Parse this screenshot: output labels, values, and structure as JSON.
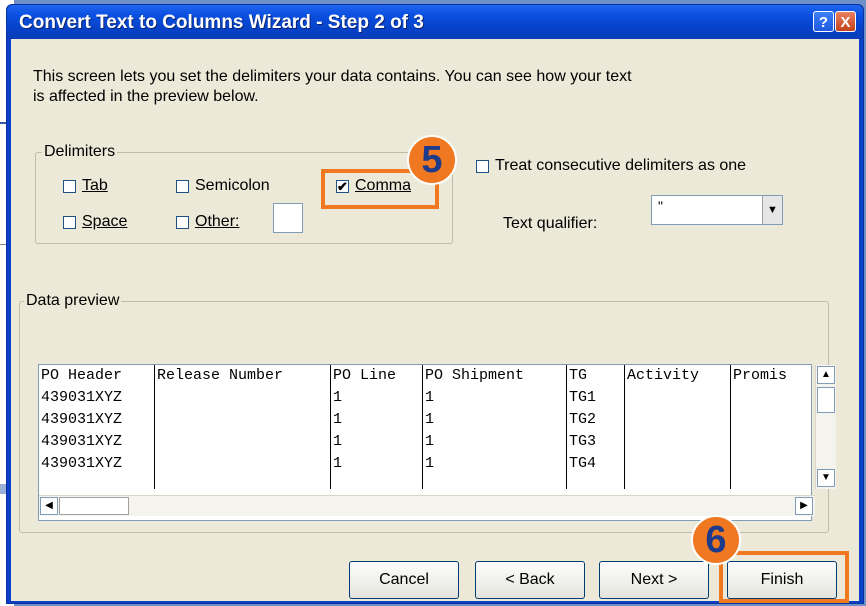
{
  "window": {
    "title": "Convert Text to Columns Wizard - Step 2 of 3",
    "help_glyph": "?",
    "close_glyph": "X"
  },
  "description": "This screen lets you set the delimiters your data contains.  You can see how your text is affected in the preview below.",
  "delimiters": {
    "legend": "Delimiters",
    "tab": {
      "label": "Tab",
      "checked": false
    },
    "semicolon": {
      "label": "Semicolon",
      "checked": false
    },
    "comma": {
      "label": "Comma",
      "checked": true,
      "check_glyph": "✔"
    },
    "space": {
      "label": "Space",
      "checked": false
    },
    "other": {
      "label": "Other:",
      "checked": false,
      "value": ""
    }
  },
  "consecutive": {
    "label": "Treat consecutive delimiters as one",
    "checked": false
  },
  "text_qualifier": {
    "label": "Text qualifier:",
    "value": "\""
  },
  "data_preview": {
    "legend": "Data preview",
    "columns": [
      {
        "cells": [
          "PO Header",
          "439031XYZ",
          "439031XYZ",
          "439031XYZ",
          "439031XYZ"
        ]
      },
      {
        "cells": [
          "Release Number",
          "",
          "",
          "",
          ""
        ]
      },
      {
        "cells": [
          "PO Line",
          "1",
          "1",
          "1",
          "1"
        ]
      },
      {
        "cells": [
          "PO Shipment",
          "1",
          "1",
          "1",
          "1"
        ]
      },
      {
        "cells": [
          "TG",
          "TG1",
          "TG2",
          "TG3",
          "TG4"
        ]
      },
      {
        "cells": [
          "Activity",
          "",
          "",
          "",
          ""
        ]
      },
      {
        "cells": [
          "Promis",
          "",
          "",
          "",
          ""
        ]
      }
    ]
  },
  "buttons": {
    "cancel": "Cancel",
    "back": "< Back",
    "next": "Next >",
    "finish": "Finish"
  },
  "callouts": {
    "step5": "5",
    "step6": "6"
  },
  "colors": {
    "callout": "#f07820",
    "titlebar": "#0a4fe0"
  },
  "icons": {
    "up": "▲",
    "down": "▼",
    "left": "◀",
    "right": "▶",
    "combo": "▼"
  }
}
